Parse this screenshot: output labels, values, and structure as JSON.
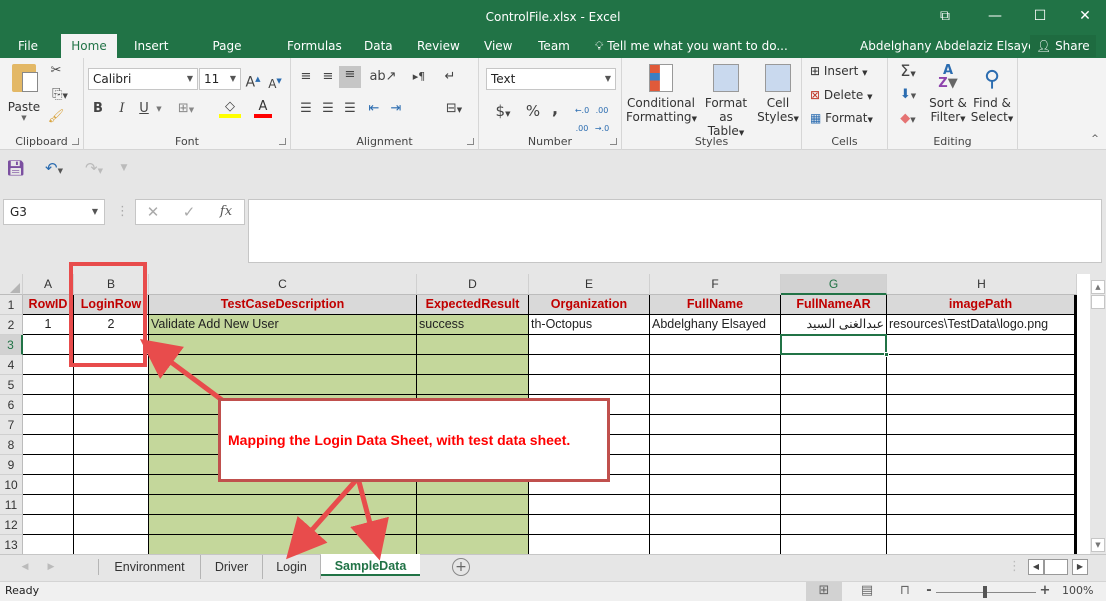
{
  "window": {
    "title": "ControlFile.xlsx - Excel",
    "controls": {
      "ribbon_display": "⧉",
      "minimize": "—",
      "maximize": "☐",
      "close": "✕"
    }
  },
  "ribbon_tabs": [
    "File",
    "Home",
    "Insert",
    "Page Layout",
    "Formulas",
    "Data",
    "Review",
    "View",
    "Team"
  ],
  "active_tab": "Home",
  "tell_me": "Tell me what you want to do...",
  "user_name": "Abdelghany Abdelaziz Elsayed",
  "share_label": "Share",
  "ribbon": {
    "clipboard": {
      "label": "Clipboard",
      "paste": "Paste"
    },
    "font": {
      "label": "Font",
      "font_name": "Calibri",
      "font_size": "11",
      "bold": "B",
      "italic": "I",
      "underline": "U",
      "fill_color": "#ffff00",
      "font_color": "#ff0000"
    },
    "alignment": {
      "label": "Alignment"
    },
    "number": {
      "label": "Number",
      "format": "Text",
      "currency": "$",
      "percent": "%",
      "comma": ","
    },
    "styles": {
      "label": "Styles",
      "conditional_formatting": [
        "Conditional",
        "Formatting"
      ],
      "format_as_table": [
        "Format as",
        "Table"
      ],
      "cell_styles": [
        "Cell",
        "Styles"
      ]
    },
    "cells": {
      "label": "Cells",
      "insert": "Insert",
      "delete": "Delete",
      "format": "Format"
    },
    "editing": {
      "label": "Editing",
      "sort_filter": [
        "Sort &",
        "Filter"
      ],
      "find_select": [
        "Find &",
        "Select"
      ]
    }
  },
  "formula_bar": {
    "name_box": "G3",
    "fx": "fx",
    "formula": ""
  },
  "sheet": {
    "columns": [
      "A",
      "B",
      "C",
      "D",
      "E",
      "F",
      "G",
      "H"
    ],
    "selected_column": "G",
    "rows": [
      "1",
      "2",
      "3",
      "4",
      "5",
      "6",
      "7",
      "8",
      "9",
      "10",
      "11",
      "12",
      "13"
    ],
    "selected_row": "3",
    "selected_cell": "G3",
    "headers": [
      "RowID",
      "LoginRow",
      "TestCaseDescription",
      "ExpectedResult",
      "Organization",
      "FullName",
      "FullNameAR",
      "imagePath"
    ],
    "data_rows": [
      [
        "1",
        "2",
        "Validate Add New User",
        "success",
        "th-Octopus",
        "Abdelghany Elsayed",
        "عبدالغنى السيد",
        "resources\\TestData\\logo.png"
      ]
    ],
    "header_text_color": "#c00000",
    "green_fill": "#c4d79b"
  },
  "annotation": {
    "text": "Mapping the Login Data Sheet, with test data sheet.",
    "color": "#ff0000"
  },
  "sheet_tabs": [
    "Environment",
    "Driver",
    "Login",
    "SampleData"
  ],
  "active_sheet": "SampleData",
  "status": {
    "ready": "Ready",
    "zoom": "100%"
  }
}
